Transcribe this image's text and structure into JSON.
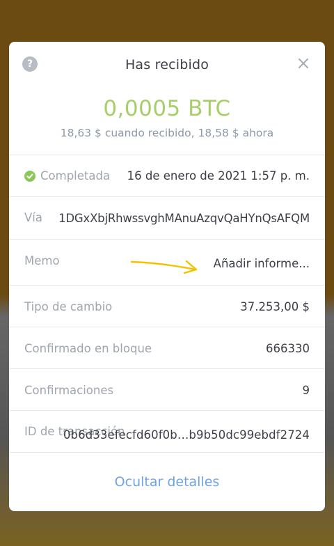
{
  "dialog": {
    "title": "Has recibido",
    "amount": "0,0005  BTC",
    "fiat_then": "18,63 $",
    "fiat_then_suffix": " cuando recibido, ",
    "fiat_now": "18,58 $",
    "fiat_now_suffix": " ahora"
  },
  "details": {
    "status_label": "Completada",
    "status_date": "16 de enero de 2021 1:57 p. m.",
    "via_label": "Vía",
    "via_value": "1DGxXbjRhwssvghMAnuAzqvQaHYnQsAFQM",
    "memo_label": "Memo",
    "memo_placeholder": "Añadir informe...",
    "rate_label": "Tipo de cambio",
    "rate_value": "37.253,00 $",
    "block_label": "Confirmado en bloque",
    "block_value": "666330",
    "confirmations_label": "Confirmaciones",
    "confirmations_value": "9",
    "txid_label": "ID de transacción",
    "txid_value": "0b6d33efecfd60f0b…b9b50dc99ebdf2724"
  },
  "footer": {
    "hide_label": "Ocultar detalles"
  },
  "colors": {
    "amount_green": "#a6cf6a",
    "link_blue": "#6fa4e4",
    "status_green": "#8cc75a",
    "annotation_arrow": "#f2c200"
  },
  "icons": [
    "help-icon",
    "close-icon",
    "check-icon",
    "arrow-annotation"
  ]
}
